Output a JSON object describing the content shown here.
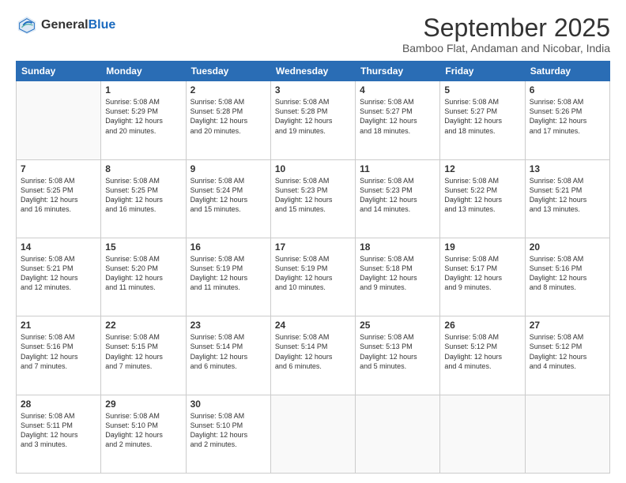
{
  "logo": {
    "general": "General",
    "blue": "Blue"
  },
  "header": {
    "month": "September 2025",
    "location": "Bamboo Flat, Andaman and Nicobar, India"
  },
  "days": [
    "Sunday",
    "Monday",
    "Tuesday",
    "Wednesday",
    "Thursday",
    "Friday",
    "Saturday"
  ],
  "weeks": [
    [
      {
        "day": "",
        "info": ""
      },
      {
        "day": "1",
        "info": "Sunrise: 5:08 AM\nSunset: 5:29 PM\nDaylight: 12 hours\nand 20 minutes."
      },
      {
        "day": "2",
        "info": "Sunrise: 5:08 AM\nSunset: 5:28 PM\nDaylight: 12 hours\nand 20 minutes."
      },
      {
        "day": "3",
        "info": "Sunrise: 5:08 AM\nSunset: 5:28 PM\nDaylight: 12 hours\nand 19 minutes."
      },
      {
        "day": "4",
        "info": "Sunrise: 5:08 AM\nSunset: 5:27 PM\nDaylight: 12 hours\nand 18 minutes."
      },
      {
        "day": "5",
        "info": "Sunrise: 5:08 AM\nSunset: 5:27 PM\nDaylight: 12 hours\nand 18 minutes."
      },
      {
        "day": "6",
        "info": "Sunrise: 5:08 AM\nSunset: 5:26 PM\nDaylight: 12 hours\nand 17 minutes."
      }
    ],
    [
      {
        "day": "7",
        "info": "Sunrise: 5:08 AM\nSunset: 5:25 PM\nDaylight: 12 hours\nand 16 minutes."
      },
      {
        "day": "8",
        "info": "Sunrise: 5:08 AM\nSunset: 5:25 PM\nDaylight: 12 hours\nand 16 minutes."
      },
      {
        "day": "9",
        "info": "Sunrise: 5:08 AM\nSunset: 5:24 PM\nDaylight: 12 hours\nand 15 minutes."
      },
      {
        "day": "10",
        "info": "Sunrise: 5:08 AM\nSunset: 5:23 PM\nDaylight: 12 hours\nand 15 minutes."
      },
      {
        "day": "11",
        "info": "Sunrise: 5:08 AM\nSunset: 5:23 PM\nDaylight: 12 hours\nand 14 minutes."
      },
      {
        "day": "12",
        "info": "Sunrise: 5:08 AM\nSunset: 5:22 PM\nDaylight: 12 hours\nand 13 minutes."
      },
      {
        "day": "13",
        "info": "Sunrise: 5:08 AM\nSunset: 5:21 PM\nDaylight: 12 hours\nand 13 minutes."
      }
    ],
    [
      {
        "day": "14",
        "info": "Sunrise: 5:08 AM\nSunset: 5:21 PM\nDaylight: 12 hours\nand 12 minutes."
      },
      {
        "day": "15",
        "info": "Sunrise: 5:08 AM\nSunset: 5:20 PM\nDaylight: 12 hours\nand 11 minutes."
      },
      {
        "day": "16",
        "info": "Sunrise: 5:08 AM\nSunset: 5:19 PM\nDaylight: 12 hours\nand 11 minutes."
      },
      {
        "day": "17",
        "info": "Sunrise: 5:08 AM\nSunset: 5:19 PM\nDaylight: 12 hours\nand 10 minutes."
      },
      {
        "day": "18",
        "info": "Sunrise: 5:08 AM\nSunset: 5:18 PM\nDaylight: 12 hours\nand 9 minutes."
      },
      {
        "day": "19",
        "info": "Sunrise: 5:08 AM\nSunset: 5:17 PM\nDaylight: 12 hours\nand 9 minutes."
      },
      {
        "day": "20",
        "info": "Sunrise: 5:08 AM\nSunset: 5:16 PM\nDaylight: 12 hours\nand 8 minutes."
      }
    ],
    [
      {
        "day": "21",
        "info": "Sunrise: 5:08 AM\nSunset: 5:16 PM\nDaylight: 12 hours\nand 7 minutes."
      },
      {
        "day": "22",
        "info": "Sunrise: 5:08 AM\nSunset: 5:15 PM\nDaylight: 12 hours\nand 7 minutes."
      },
      {
        "day": "23",
        "info": "Sunrise: 5:08 AM\nSunset: 5:14 PM\nDaylight: 12 hours\nand 6 minutes."
      },
      {
        "day": "24",
        "info": "Sunrise: 5:08 AM\nSunset: 5:14 PM\nDaylight: 12 hours\nand 6 minutes."
      },
      {
        "day": "25",
        "info": "Sunrise: 5:08 AM\nSunset: 5:13 PM\nDaylight: 12 hours\nand 5 minutes."
      },
      {
        "day": "26",
        "info": "Sunrise: 5:08 AM\nSunset: 5:12 PM\nDaylight: 12 hours\nand 4 minutes."
      },
      {
        "day": "27",
        "info": "Sunrise: 5:08 AM\nSunset: 5:12 PM\nDaylight: 12 hours\nand 4 minutes."
      }
    ],
    [
      {
        "day": "28",
        "info": "Sunrise: 5:08 AM\nSunset: 5:11 PM\nDaylight: 12 hours\nand 3 minutes."
      },
      {
        "day": "29",
        "info": "Sunrise: 5:08 AM\nSunset: 5:10 PM\nDaylight: 12 hours\nand 2 minutes."
      },
      {
        "day": "30",
        "info": "Sunrise: 5:08 AM\nSunset: 5:10 PM\nDaylight: 12 hours\nand 2 minutes."
      },
      {
        "day": "",
        "info": ""
      },
      {
        "day": "",
        "info": ""
      },
      {
        "day": "",
        "info": ""
      },
      {
        "day": "",
        "info": ""
      }
    ]
  ]
}
